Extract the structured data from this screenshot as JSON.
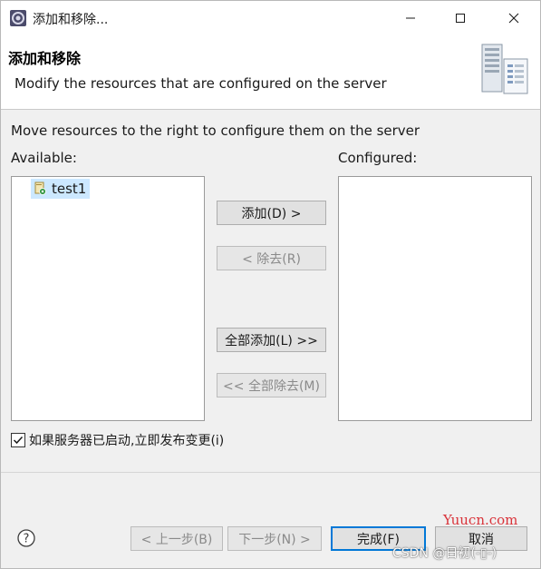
{
  "window": {
    "title": "添加和移除..."
  },
  "banner": {
    "title": "添加和移除",
    "description": "Modify the resources that are configured on the server"
  },
  "content": {
    "instruction": "Move resources to the right to configure them on the server",
    "available_label": "Available:",
    "configured_label": "Configured:",
    "available_items": [
      {
        "label": "test1",
        "selected": true
      }
    ],
    "configured_items": []
  },
  "buttons": {
    "add": "添加(D) >",
    "remove": "< 除去(R)",
    "add_all": "全部添加(L) >>",
    "remove_all": "<< 全部除去(M)",
    "back": "< 上一步(B)",
    "next": "下一步(N) >",
    "finish": "完成(F)",
    "cancel": "取消"
  },
  "options": {
    "publish_immediately_label": "如果服务器已启动,立即发布变更(i)",
    "publish_immediately_checked": true
  },
  "watermarks": {
    "brand": "Yuucn.com",
    "csdn": "CSDN @日初(-▯-)"
  },
  "colors": {
    "selection": "#cce8ff",
    "default_button_border": "#0078d7",
    "watermark_brand": "#d9333a"
  }
}
